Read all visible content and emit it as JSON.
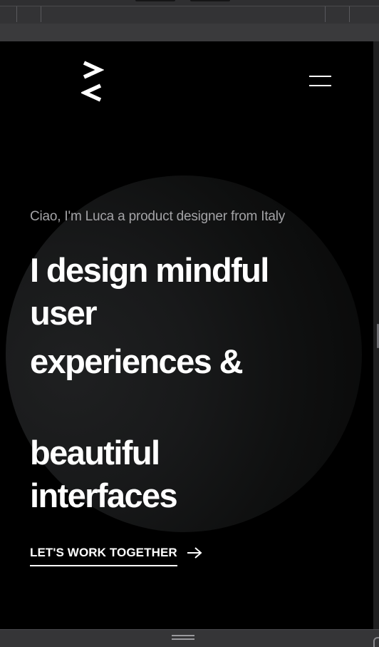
{
  "hero": {
    "intro": "Ciao, I'm Luca a product designer from Italy",
    "headline_lines": [
      "I design mindful",
      "user",
      "experiences &",
      "beautiful",
      "interfaces"
    ],
    "cta_label": "LET'S WORK TOGETHER"
  },
  "icons": {
    "logo": "logo-mark",
    "menu": "hamburger-menu-icon",
    "cta": "arrow-right-icon",
    "bottom_bar": "resize-handle-icon"
  },
  "colors": {
    "page_background": "#000000",
    "circle": "#1c1d1e",
    "text_primary": "#ffffff",
    "text_muted": "#a3a3a6",
    "editor_chrome": "#2f2f31"
  }
}
